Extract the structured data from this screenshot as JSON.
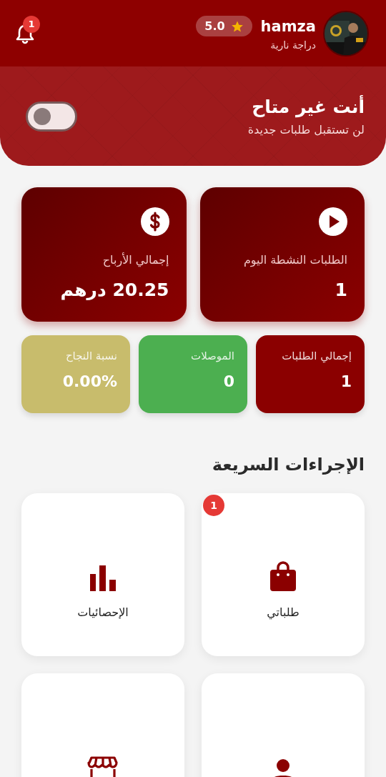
{
  "header": {
    "notification_count": "1",
    "user": {
      "name": "hamza",
      "rating": "5.0",
      "vehicle": "دراجة نارية"
    }
  },
  "availability": {
    "title": "أنت غير متاح",
    "subtitle": "لن تستقبل طلبات جديدة",
    "on": false
  },
  "main_stats": [
    {
      "kind": "play",
      "label": "الطلبات النشطة اليوم",
      "value": "1"
    },
    {
      "kind": "dollar",
      "label": "إجمالي الأرباح",
      "value": "20.25 درهم"
    }
  ],
  "small_stats": [
    {
      "label": "إجمالي الطلبات",
      "value": "1",
      "color": "#8b0000"
    },
    {
      "label": "الموصلات",
      "value": "0",
      "color": "#4caf50"
    },
    {
      "label": "نسبة النجاح",
      "value": "0.00%",
      "color": "#c8bc6c"
    }
  ],
  "quick_actions": {
    "title": "الإجراءات السريعة",
    "items": [
      {
        "kind": "bag",
        "label": "طلباتي",
        "badge": "1"
      },
      {
        "kind": "chart",
        "label": "الإحصائيات"
      },
      {
        "kind": "person"
      },
      {
        "kind": "store"
      }
    ]
  }
}
